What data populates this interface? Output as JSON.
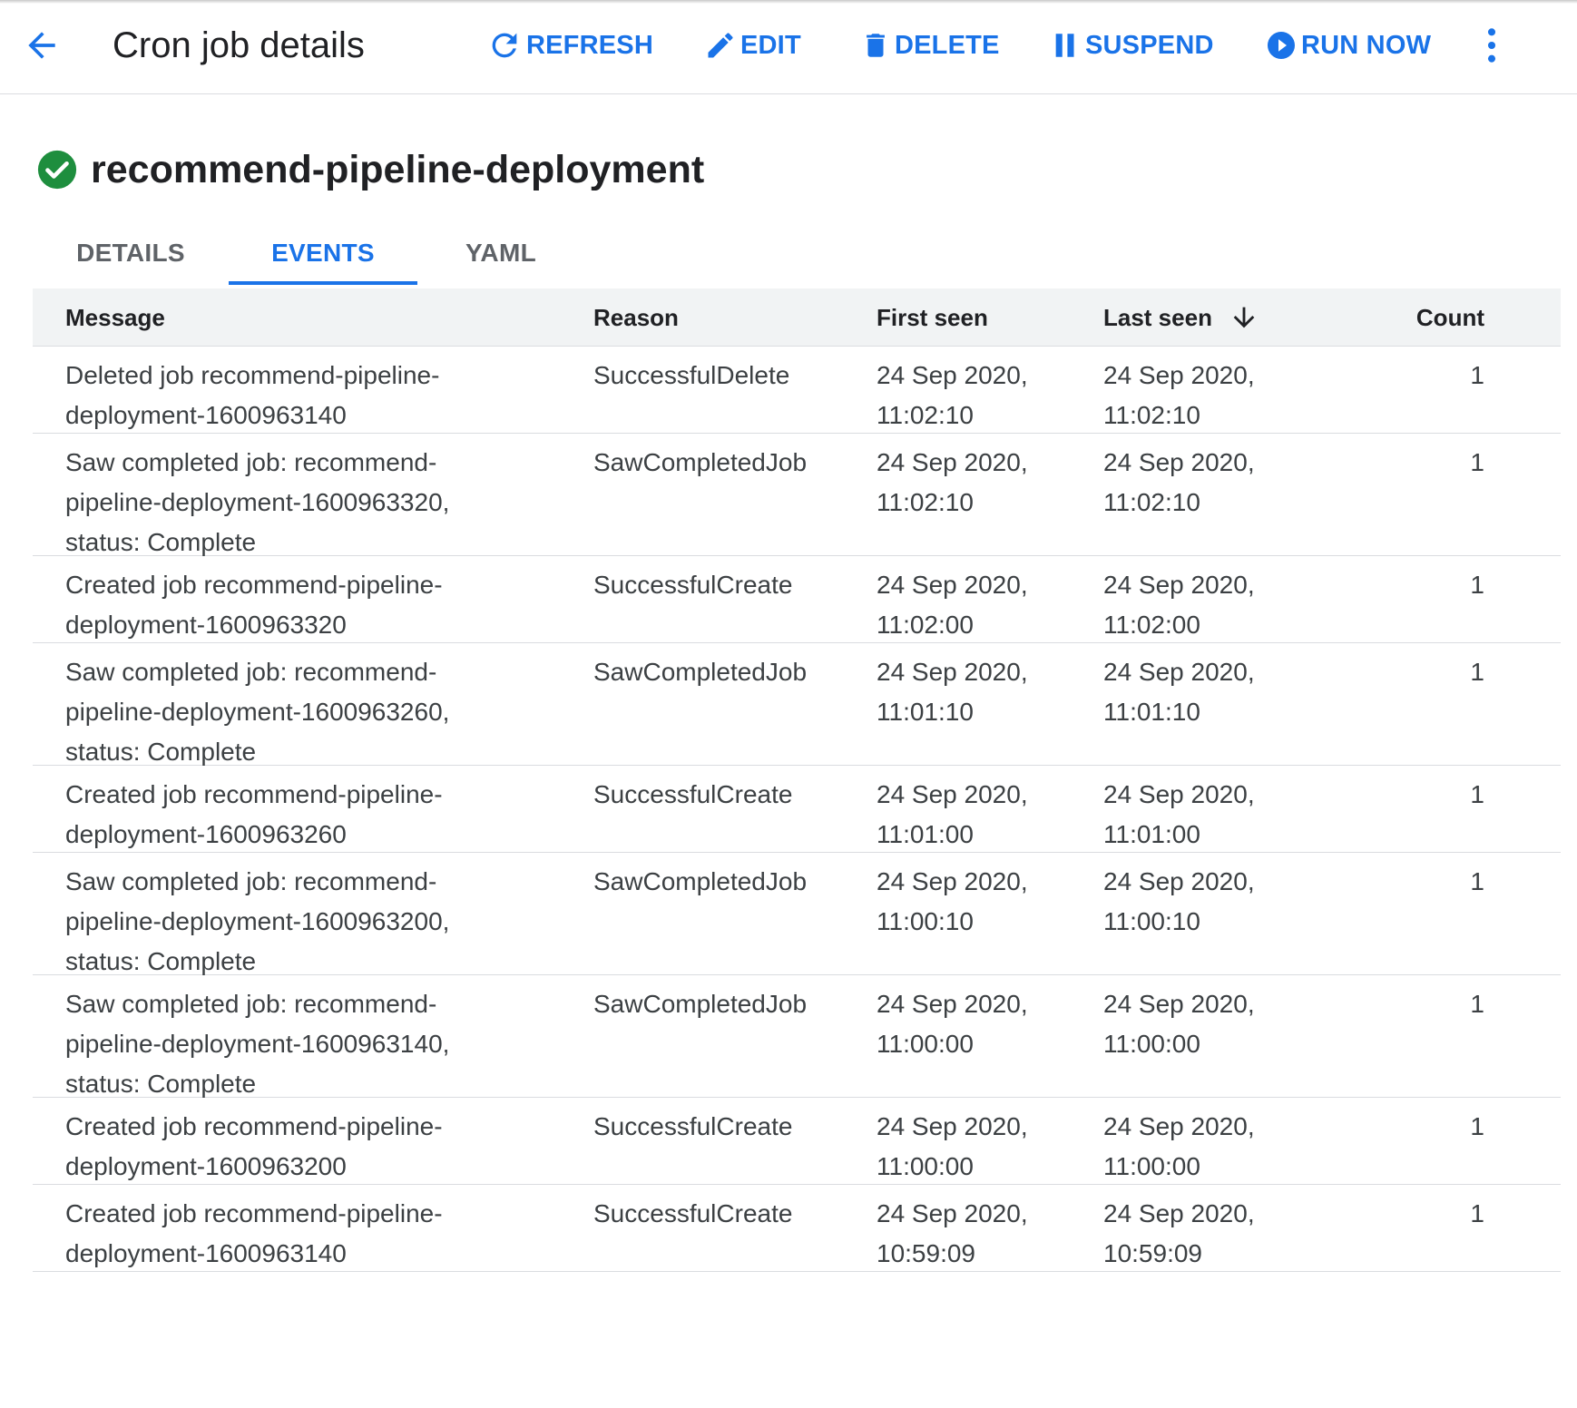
{
  "header": {
    "title": "Cron job details",
    "actions": [
      {
        "label": "REFRESH",
        "icon": "refresh-icon"
      },
      {
        "label": "EDIT",
        "icon": "pencil-icon"
      },
      {
        "label": "DELETE",
        "icon": "trash-icon"
      },
      {
        "label": "SUSPEND",
        "icon": "pause-icon"
      },
      {
        "label": "RUN NOW",
        "icon": "play-circle-icon"
      }
    ],
    "more_icon": "more-vert-icon",
    "back_icon": "arrow-back-icon"
  },
  "resource": {
    "name": "recommend-pipeline-deployment",
    "status_icon": "check-circle-icon",
    "status_color": "#1e8e3e"
  },
  "tabs": [
    {
      "label": "DETAILS",
      "active": false
    },
    {
      "label": "EVENTS",
      "active": true
    },
    {
      "label": "YAML",
      "active": false
    }
  ],
  "table": {
    "columns": [
      "Message",
      "Reason",
      "First seen",
      "Last seen",
      "Count"
    ],
    "sort_icon": "arrow-downward-icon",
    "rows": [
      {
        "message": [
          "Deleted job recommend-pipeline-",
          "deployment-1600963140"
        ],
        "reason": "SuccessfulDelete",
        "first_seen": [
          "24 Sep 2020,",
          "11:02:10"
        ],
        "last_seen": [
          "24 Sep 2020,",
          "11:02:10"
        ],
        "count": "1"
      },
      {
        "message": [
          "Saw completed job: recommend-",
          "pipeline-deployment-1600963320,",
          "status: Complete"
        ],
        "reason": "SawCompletedJob",
        "first_seen": [
          "24 Sep 2020,",
          "11:02:10"
        ],
        "last_seen": [
          "24 Sep 2020,",
          "11:02:10"
        ],
        "count": "1"
      },
      {
        "message": [
          "Created job recommend-pipeline-",
          "deployment-1600963320"
        ],
        "reason": "SuccessfulCreate",
        "first_seen": [
          "24 Sep 2020,",
          "11:02:00"
        ],
        "last_seen": [
          "24 Sep 2020,",
          "11:02:00"
        ],
        "count": "1"
      },
      {
        "message": [
          "Saw completed job: recommend-",
          "pipeline-deployment-1600963260,",
          "status: Complete"
        ],
        "reason": "SawCompletedJob",
        "first_seen": [
          "24 Sep 2020,",
          "11:01:10"
        ],
        "last_seen": [
          "24 Sep 2020,",
          "11:01:10"
        ],
        "count": "1"
      },
      {
        "message": [
          "Created job recommend-pipeline-",
          "deployment-1600963260"
        ],
        "reason": "SuccessfulCreate",
        "first_seen": [
          "24 Sep 2020,",
          "11:01:00"
        ],
        "last_seen": [
          "24 Sep 2020,",
          "11:01:00"
        ],
        "count": "1"
      },
      {
        "message": [
          "Saw completed job: recommend-",
          "pipeline-deployment-1600963200,",
          "status: Complete"
        ],
        "reason": "SawCompletedJob",
        "first_seen": [
          "24 Sep 2020,",
          "11:00:10"
        ],
        "last_seen": [
          "24 Sep 2020,",
          "11:00:10"
        ],
        "count": "1"
      },
      {
        "message": [
          "Saw completed job: recommend-",
          "pipeline-deployment-1600963140,",
          "status: Complete"
        ],
        "reason": "SawCompletedJob",
        "first_seen": [
          "24 Sep 2020,",
          "11:00:00"
        ],
        "last_seen": [
          "24 Sep 2020,",
          "11:00:00"
        ],
        "count": "1"
      },
      {
        "message": [
          "Created job recommend-pipeline-",
          "deployment-1600963200"
        ],
        "reason": "SuccessfulCreate",
        "first_seen": [
          "24 Sep 2020,",
          "11:00:00"
        ],
        "last_seen": [
          "24 Sep 2020,",
          "11:00:00"
        ],
        "count": "1"
      },
      {
        "message": [
          "Created job recommend-pipeline-",
          "deployment-1600963140"
        ],
        "reason": "SuccessfulCreate",
        "first_seen": [
          "24 Sep 2020,",
          "10:59:09"
        ],
        "last_seen": [
          "24 Sep 2020,",
          "10:59:09"
        ],
        "count": "1"
      }
    ]
  },
  "colors": {
    "accent": "#1a73e8",
    "text": "#202124",
    "muted_text": "#3c4043",
    "header_bg": "#f1f3f4",
    "divider": "#dadce0"
  }
}
